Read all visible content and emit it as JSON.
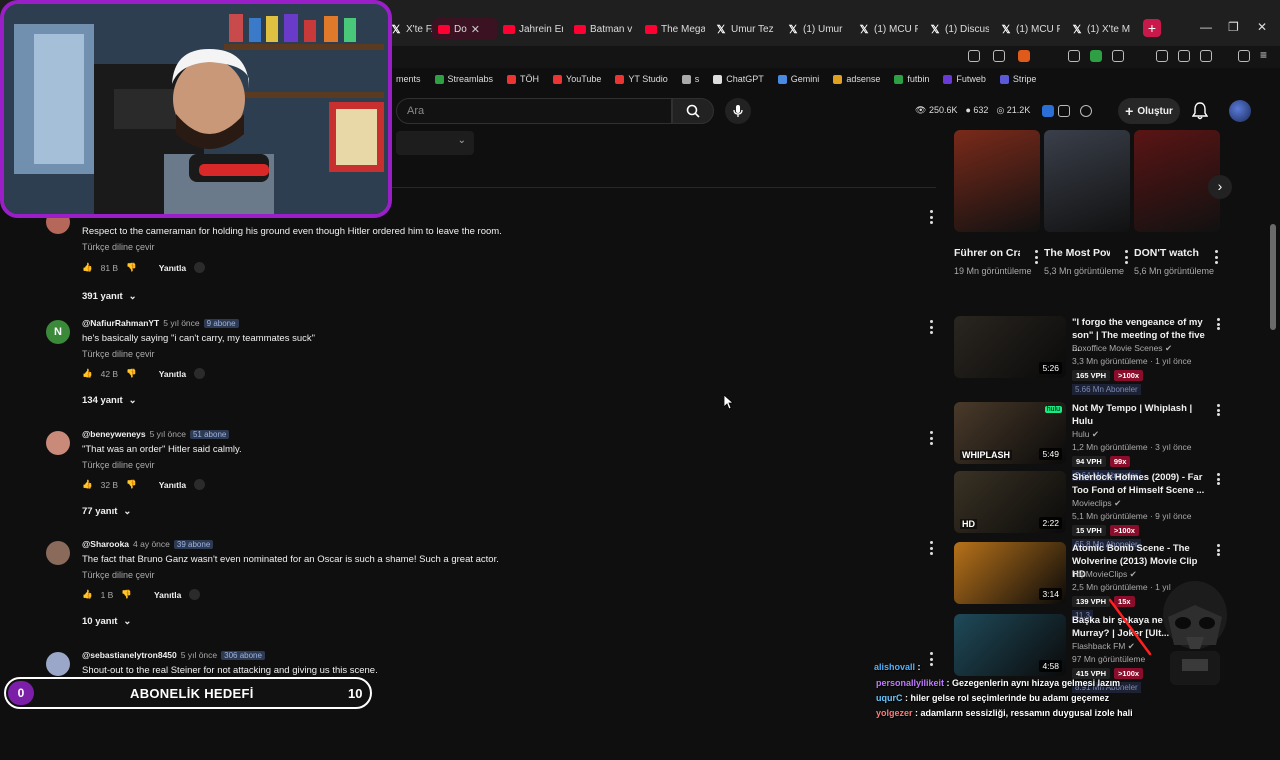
{
  "browser": {
    "tabs": [
      {
        "label": "X'te FA",
        "icon": "x"
      },
      {
        "label": "Do",
        "icon": "yt",
        "active": true
      },
      {
        "label": "Jahrein Eri",
        "icon": "yt"
      },
      {
        "label": "Batman v S",
        "icon": "yt"
      },
      {
        "label": "The Mega",
        "icon": "yt"
      },
      {
        "label": "Umur Tez",
        "icon": "x"
      },
      {
        "label": "(1) Umur",
        "icon": "x"
      },
      {
        "label": "(1) MCU F",
        "icon": "x"
      },
      {
        "label": "(1) Discus",
        "icon": "x"
      },
      {
        "label": "(1) MCU F",
        "icon": "x"
      },
      {
        "label": "(1) X'te M",
        "icon": "x"
      }
    ],
    "bookmarks": [
      "ments",
      "Streamlabs",
      "TÖH",
      "YouTube",
      "YT Studio",
      "s",
      "ChatGPT",
      "Gemini",
      "adsense",
      "futbin",
      "Futweb",
      "Stripe"
    ]
  },
  "header": {
    "search_placeholder": "Ara",
    "stats": {
      "a": "250.6K",
      "b": "632",
      "c": "21.2K"
    },
    "create_label": "Oluştur"
  },
  "comments": [
    {
      "user": "",
      "age": "",
      "subs": "",
      "text": "Respect to the cameraman for holding his ground even though Hitler ordered him to leave the room.",
      "translate": "Türkçe diline çevir",
      "likes": "81 B",
      "reply": "Yanıtla",
      "replies": "391 yanıt",
      "avatar": "",
      "avatar_color": "#b5675a"
    },
    {
      "user": "@NafiurRahmanYT",
      "age": "5 yıl önce",
      "subs": "9 abone",
      "text": "he's basically saying \"i can't carry, my teammates suck\"",
      "translate": "Türkçe diline çevir",
      "likes": "42 B",
      "reply": "Yanıtla",
      "replies": "134 yanıt",
      "avatar": "N",
      "avatar_color": "#3a8a3a"
    },
    {
      "user": "@beneyweneys",
      "age": "5 yıl önce",
      "subs": "51 abone",
      "text": "\"That was an order\" Hitler said calmly.",
      "translate": "Türkçe diline çevir",
      "likes": "32 B",
      "reply": "Yanıtla",
      "replies": "77 yanıt",
      "avatar": "",
      "avatar_color": "#c98a7a"
    },
    {
      "user": "@Sharooka",
      "age": "4 ay önce",
      "subs": "39 abone",
      "text": "The fact that Bruno Ganz wasn't even nominated for an Oscar is such a shame! Such a great actor.",
      "translate": "Türkçe diline çevir",
      "likes": "1 B",
      "reply": "Yanıtla",
      "replies": "10 yanıt",
      "avatar": "",
      "avatar_color": "#8a6a5a"
    },
    {
      "user": "@sebastianelytron8450",
      "age": "5 yıl önce",
      "subs": "306 abone",
      "text": "Shout-out to the real Steiner for not attacking and giving us this scene.",
      "translate": "Türkçe diline çevir",
      "likes": "",
      "reply": "",
      "replies": "",
      "avatar": "",
      "avatar_color": "#9aa7c9"
    }
  ],
  "shorts": [
    {
      "title": "Führer on Crack... 🤡 ...",
      "views": "19 Mn görüntüleme",
      "color": "#7a2a1a"
    },
    {
      "title": "The Most Powerful ...",
      "views": "5,3 Mn görüntüleme",
      "color": "#3a3f4a"
    },
    {
      "title": "DON'T watch this scene i...",
      "views": "5,6 Mn görüntüleme",
      "color": "#5a1414"
    }
  ],
  "videos": [
    {
      "title": "\"I forgo the vengeance of my son\" | The meeting of the five ...",
      "channel": "Boxoffice Movie Scenes",
      "meta": "3,3 Mn görüntüleme · 1 yıl önce",
      "duration": "5:26",
      "vph": "165 VPH",
      "hot": ">100x",
      "subs": "5.66 Mn Aboneler",
      "color": "#2a2620"
    },
    {
      "title": "Not My Tempo | Whiplash | Hulu",
      "channel": "Hulu",
      "meta": "1,2 Mn görüntüleme · 3 yıl önce",
      "duration": "5:49",
      "vph": "94 VPH",
      "hot": "99x",
      "subs": "2.64 Mn Aboneler",
      "color": "#4a3a2a",
      "thumb_text": "WHIPLASH",
      "thumb_badge": "hulu"
    },
    {
      "title": "Sherlock Holmes (2009) - Far Too Fond of Himself Scene ...",
      "channel": "Movieclips",
      "meta": "5,1 Mn görüntüleme · 9 yıl önce",
      "duration": "2:22",
      "vph": "15 VPH",
      "hot": ">100x",
      "subs": "65.8 Mn Aboneler",
      "color": "#3a3224",
      "thumb_text": "HD"
    },
    {
      "title": "Atomic Bomb Scene - The Wolverine (2013) Movie Clip HD",
      "channel": "TopMovieClips",
      "meta": "2,5 Mn görüntüleme · 1 yıl",
      "duration": "3:14",
      "vph": "139 VPH",
      "hot": "15x",
      "subs": "11.3",
      "color": "#b8721a"
    },
    {
      "title": "Başka bir şakaya ne d... Murray? | Joker [Ult...",
      "channel": "Flashback FM",
      "meta": "97 Mn görüntüleme",
      "duration": "4:58",
      "vph": "415 VPH",
      "hot": ">100x",
      "subs": "8.91 Mn Aboneler",
      "color": "#1f4a5a"
    }
  ],
  "overlay": {
    "goal_current": "0",
    "goal_label": "ABONELİK HEDEFİ",
    "goal_target": "10",
    "chat": [
      {
        "user": "alishovall",
        "text": ":",
        "cls": "u1"
      },
      {
        "user": "personallyilikeit",
        "text": ": Gezegenlerin aynı hizaya gelmesi lazım",
        "cls": "u2"
      },
      {
        "user": "uqurC",
        "text": ": hiler gelse rol seçimlerinde bu adamı geçemez",
        "cls": "u3"
      },
      {
        "user": "yolgezer",
        "text": ": adamların sessizliği, ressamın duygusal izole hali",
        "cls": "u4"
      }
    ]
  },
  "colors": {
    "accent": "#9b1fc8",
    "youtube_red": "#ff0033"
  }
}
